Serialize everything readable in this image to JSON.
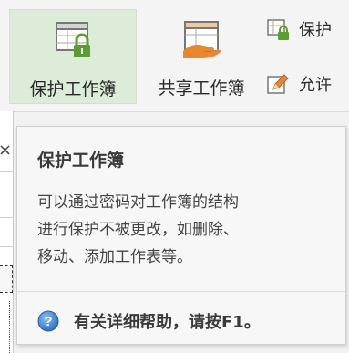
{
  "ribbon": {
    "protect_workbook_label": "保护工作簿",
    "share_workbook_label": "共享工作簿",
    "protect_sheet_label": "保护",
    "allow_edit_label": "允许"
  },
  "sidebar_strip": {
    "close_glyph": "×"
  },
  "tooltip": {
    "title": "保护工作簿",
    "body_lines": [
      "可以通过密码对工作簿的结构",
      "进行保护不被更改，如删除、",
      "移动、添加工作表等。"
    ],
    "help_text": "有关详细帮助，请按F1。"
  },
  "icons": {
    "protect_workbook": "lock-workbook-icon",
    "share_workbook": "share-workbook-icon",
    "protect_sheet": "lock-sheet-icon",
    "allow_edit": "edit-ranges-icon",
    "help": "help-icon"
  },
  "colors": {
    "accent_green": "#5a9e2f",
    "active_bg": "#dcecd9",
    "share_orange": "#e8872e",
    "help_blue": "#3a7fd0"
  }
}
